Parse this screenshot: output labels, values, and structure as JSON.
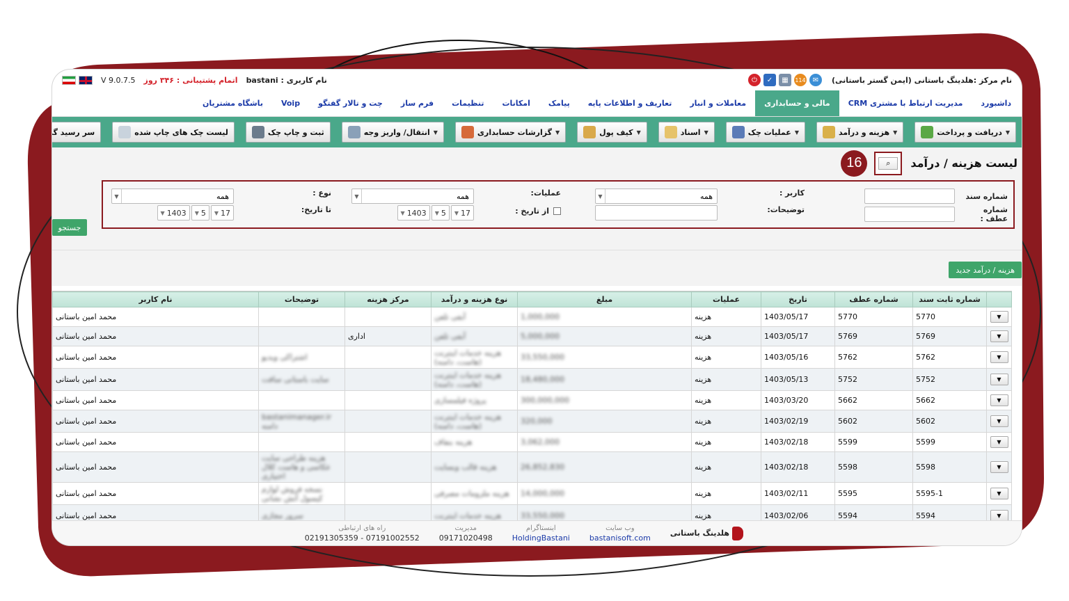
{
  "topbar": {
    "center_name": "نام مرکز :هلدینگ باستانی (ایمن گستر باستانی)",
    "user_label": "نام کاربری :",
    "user_name": "bastani",
    "remaining": "اتمام پشتیبانی : ۳۴۶ روز",
    "version": "V 9.0.7.5",
    "notif_count": "114"
  },
  "main_nav": [
    {
      "label": "داشبورد",
      "active": false
    },
    {
      "label": "مدیریت ارتباط با مشتری CRM",
      "active": false
    },
    {
      "label": "مالی و حسابداری",
      "active": true
    },
    {
      "label": "معاملات و انبار",
      "active": false
    },
    {
      "label": "تعاریف و اطلاعات پایه",
      "active": false
    },
    {
      "label": "پیامک",
      "active": false
    },
    {
      "label": "امکانات",
      "active": false
    },
    {
      "label": "تنظیمات",
      "active": false
    },
    {
      "label": "فرم ساز",
      "active": false
    },
    {
      "label": "چت و تالار گفتگو",
      "active": false
    },
    {
      "label": "Voip",
      "active": false
    },
    {
      "label": "باشگاه مشتریان",
      "active": false
    }
  ],
  "toolbar": [
    {
      "label": "دریافت و پرداخت",
      "dropdown": true
    },
    {
      "label": "هزینه و درآمد",
      "dropdown": true
    },
    {
      "label": "عملیات چک",
      "dropdown": true
    },
    {
      "label": "اسناد",
      "dropdown": true
    },
    {
      "label": "کیف پول",
      "dropdown": true
    },
    {
      "label": "گزارشات حسابداری",
      "dropdown": true
    },
    {
      "label": "انتقال/ واریز وجه",
      "dropdown": true
    },
    {
      "label": "ثبت و چاپ چک",
      "dropdown": false
    },
    {
      "label": "لیست چک های چاپ شده",
      "dropdown": false
    },
    {
      "label": "سر رسید گروهی",
      "dropdown": false
    }
  ],
  "page": {
    "title": "لیست هزینه / درآمد",
    "step_badge": "16",
    "search_icon": "search-icon"
  },
  "filters": {
    "doc_number_label": "شماره سند",
    "ref_number_label": "شماره عطف :",
    "user_label": "کاربر :",
    "user_value": "همه",
    "desc_label": "توضیحات:",
    "operation_label": "عملیات:",
    "operation_value": "همه",
    "from_date_label": "از تاریخ :",
    "from_day": "17",
    "from_month": "5",
    "from_year": "1403",
    "type_label": "نوع :",
    "type_value": "همه",
    "to_date_label": "تا تاریخ:",
    "to_day": "17",
    "to_month": "5",
    "to_year": "1403",
    "search_button": "جستجو"
  },
  "new_button": "هزینه / درآمد جدید",
  "table": {
    "headers": [
      "",
      "شماره ثابت سند",
      "شماره عطف",
      "تاریخ",
      "عملیات",
      "مبلغ",
      "نوع هزینه و درآمد",
      "مرکز هزینه",
      "توضیحات",
      "نام کاربر"
    ],
    "rows": [
      {
        "fixed": "5770",
        "ref": "5770",
        "date": "1403/05/17",
        "op": "هزینه",
        "amount": "1,000,000",
        "type": "آبفی تلفن",
        "center": "",
        "desc": "",
        "user": "محمد امین باستانی"
      },
      {
        "fixed": "5769",
        "ref": "5769",
        "date": "1403/05/17",
        "op": "هزینه",
        "amount": "5,000,000",
        "type": "آبفی تلفن",
        "center": "اداری",
        "desc": "",
        "user": "محمد امین باستانی"
      },
      {
        "fixed": "5762",
        "ref": "5762",
        "date": "1403/05/16",
        "op": "هزینه",
        "amount": "33,550,000",
        "type": "هزینه خدمات اینترنت (هاست، دامنه)",
        "center": "",
        "desc": "اشتراکی ویدیو",
        "user": "محمد امین باستانی"
      },
      {
        "fixed": "5752",
        "ref": "5752",
        "date": "1403/05/13",
        "op": "هزینه",
        "amount": "18,480,000",
        "type": "هزینه خدمات اینترنت (هاست، دامنه)",
        "center": "",
        "desc": "سایت باستانی سافت",
        "user": "محمد امین باستانی"
      },
      {
        "fixed": "5662",
        "ref": "5662",
        "date": "1403/03/20",
        "op": "هزینه",
        "amount": "300,000,000",
        "type": "پروژه فیلمسازی",
        "center": "",
        "desc": "",
        "user": "محمد امین باستانی"
      },
      {
        "fixed": "5602",
        "ref": "5602",
        "date": "1403/02/19",
        "op": "هزینه",
        "amount": "320,000",
        "type": "هزینه خدمات اینترنت (هاست، دامنه)",
        "center": "",
        "desc": "bastanimanager.ir دامنه",
        "user": "محمد امین باستانی"
      },
      {
        "fixed": "5599",
        "ref": "5599",
        "date": "1403/02/18",
        "op": "هزینه",
        "amount": "3,062,000",
        "type": "هزینه بنفاف",
        "center": "",
        "desc": "",
        "user": "محمد امین باستانی"
      },
      {
        "fixed": "5598",
        "ref": "5598",
        "date": "1403/02/18",
        "op": "هزینه",
        "amount": "26,852,830",
        "type": "هزینه قالب وبسایت",
        "center": "",
        "desc": "هزینه طراحی سایت عکاسی و هاست کلال اختیاری",
        "user": "محمد امین باستانی"
      },
      {
        "fixed": "5595-1",
        "ref": "5595",
        "date": "1403/02/11",
        "op": "هزینه",
        "amount": "14,000,000",
        "type": "هزینه ملزومات مصرفی",
        "center": "",
        "desc": "نسخه فروش لوازم کیسول آتش نشانی",
        "user": "محمد امین باستانی"
      },
      {
        "fixed": "5594",
        "ref": "5594",
        "date": "1403/02/06",
        "op": "هزینه",
        "amount": "33,550,000",
        "type": "هزینه خدمات اینترنت",
        "center": "",
        "desc": "سرور مجازی",
        "user": "محمد امین باستانی"
      }
    ]
  },
  "footer": {
    "brand": "هلدینگ باستانی",
    "website_caption": "وب سایت",
    "website": "bastanisoft.com",
    "instagram_caption": "اینستاگرام",
    "instagram": "HoldingBastani",
    "manager_caption": "مدیریت",
    "manager": "09171020498",
    "contact_caption": "راه های ارتباطی",
    "contact": "07191002552 - 02191305359"
  },
  "colors": {
    "accent_green": "#4aa88a",
    "frame_red": "#8b1a1f",
    "link_blue": "#1b3aa8"
  }
}
